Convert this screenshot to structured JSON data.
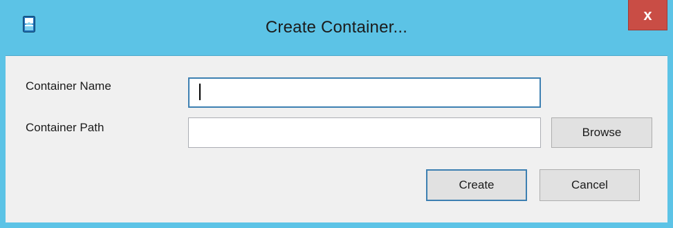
{
  "window": {
    "title": "Create Container...",
    "close_label": "x"
  },
  "form": {
    "name_label": "Container Name",
    "name_value": "",
    "path_label": "Container Path",
    "path_value": ""
  },
  "buttons": {
    "browse_label": "Browse",
    "create_label": "Create",
    "cancel_label": "Cancel"
  },
  "colors": {
    "titlebar": "#5cc3e6",
    "close_button": "#c94d45",
    "client_background": "#f0f0f0",
    "focus_border": "#3c7fb1"
  },
  "icons": {
    "app": "app-window-icon",
    "close": "close-icon"
  }
}
